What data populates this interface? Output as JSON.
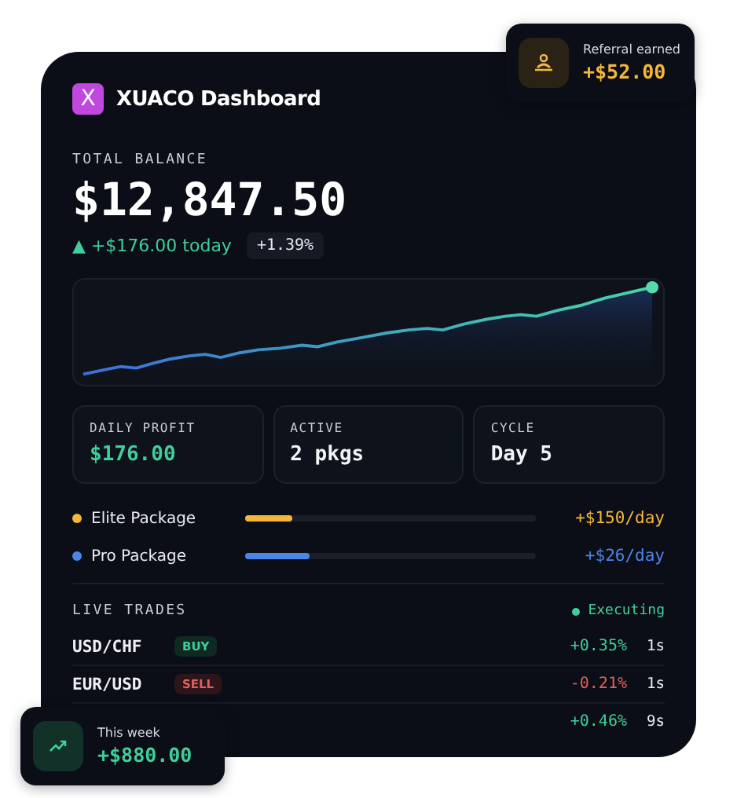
{
  "header": {
    "logo": "X",
    "title": "XUACO Dashboard"
  },
  "balance": {
    "label": "TOTAL BALANCE",
    "amount": "$12,847.50",
    "change_icon": "▲",
    "change": "+$176.00 today",
    "percent": "+1.39%"
  },
  "stats": [
    {
      "label": "DAILY PROFIT",
      "value": "$176.00",
      "kind": "positive"
    },
    {
      "label": "ACTIVE",
      "value": "2 pkgs",
      "kind": "plain"
    },
    {
      "label": "CYCLE",
      "value": "Day 5",
      "kind": "plain"
    }
  ],
  "packages": [
    {
      "name": "Elite Package",
      "color": "#f5b73b",
      "level": 0.16,
      "rate": "+$150/day"
    },
    {
      "name": "Pro Package",
      "color": "#4a86e8",
      "level": 0.22,
      "rate": "+$26/day"
    }
  ],
  "trades": {
    "title": "LIVE TRADES",
    "status": "Executing",
    "rows": [
      {
        "pair": "USD/CHF",
        "side": {
          "label": "BUY",
          "kind": "buy"
        },
        "kind": "gain",
        "change": "+0.35%",
        "age": "1s"
      },
      {
        "pair": "EUR/USD",
        "side": {
          "label": "SELL",
          "kind": "sell"
        },
        "kind": "loss",
        "change": "-0.21%",
        "age": "1s"
      },
      {
        "kind": "gain",
        "change": "+0.46%",
        "age": "9s"
      }
    ]
  },
  "referral": {
    "label": "Referral earned",
    "amount": "+$52.00"
  },
  "week": {
    "label": "This week",
    "amount": "+$880.00"
  }
}
